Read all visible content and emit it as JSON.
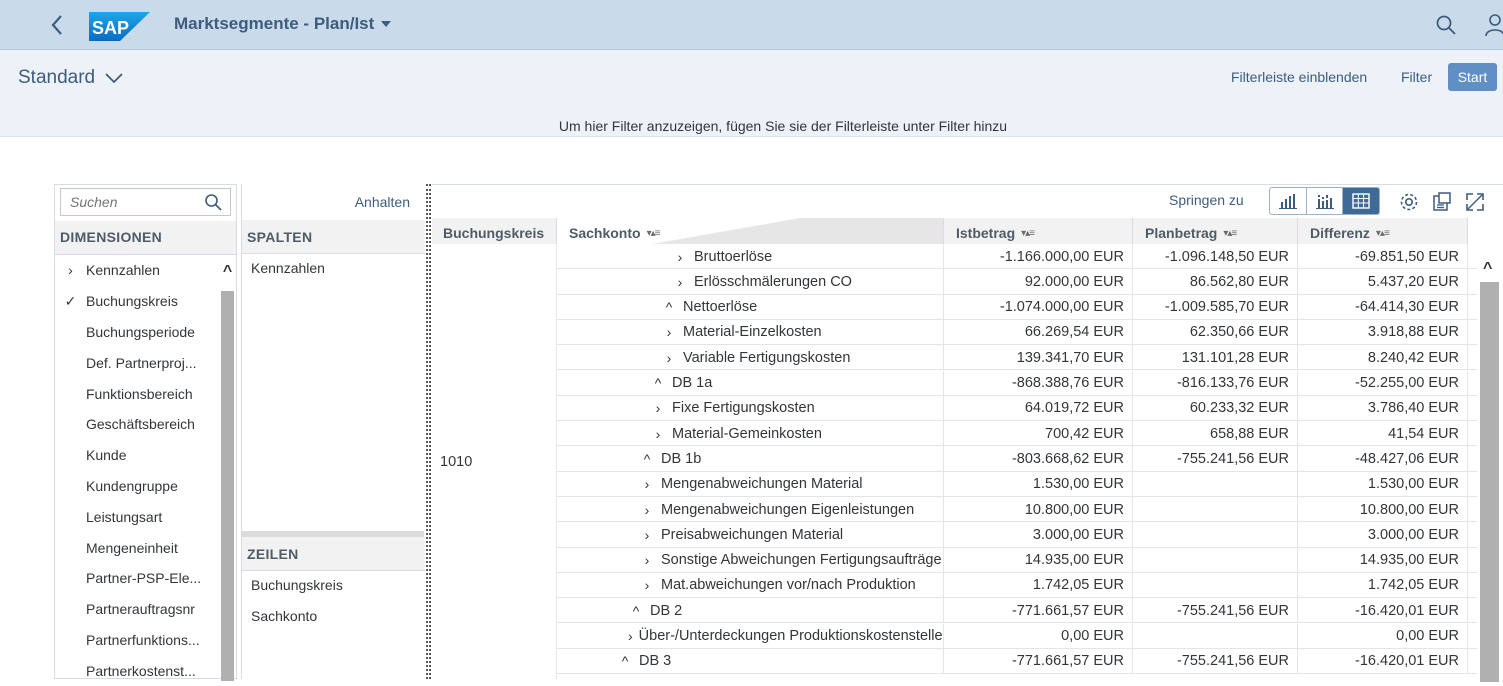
{
  "shell": {
    "logo_text": "SAP",
    "app_title": "Marktsegmente - Plan/Ist"
  },
  "header": {
    "variant": "Standard",
    "show_filterbar": "Filterleiste einblenden",
    "filter": "Filter",
    "start": "Start",
    "hint": "Um hier Filter anzuzeigen, fügen Sie sie der Filterleiste unter Filter hinzu"
  },
  "dimensions": {
    "search_placeholder": "Suchen",
    "heading": "DIMENSIONEN",
    "items": [
      {
        "marker": "›",
        "label": "Kennzahlen"
      },
      {
        "marker": "✓",
        "label": "Buchungskreis"
      },
      {
        "marker": "",
        "label": "Buchungsperiode"
      },
      {
        "marker": "",
        "label": "Def. Partnerproj..."
      },
      {
        "marker": "",
        "label": "Funktionsbereich"
      },
      {
        "marker": "",
        "label": "Geschäftsbereich"
      },
      {
        "marker": "",
        "label": "Kunde"
      },
      {
        "marker": "",
        "label": "Kundengruppe"
      },
      {
        "marker": "",
        "label": "Leistungsart"
      },
      {
        "marker": "",
        "label": "Mengeneinheit"
      },
      {
        "marker": "",
        "label": "Partner-PSP-Ele..."
      },
      {
        "marker": "",
        "label": "Partnerauftragsnr"
      },
      {
        "marker": "",
        "label": "Partnerfunktions..."
      },
      {
        "marker": "",
        "label": "Partnerkostenst..."
      }
    ]
  },
  "layout": {
    "pause": "Anhalten",
    "columns_heading": "SPALTEN",
    "columns": [
      "Kennzahlen"
    ],
    "rows_heading": "ZEILEN",
    "rows": [
      "Buchungskreis",
      "Sachkonto"
    ]
  },
  "grid_toolbar": {
    "jump_to": "Springen zu",
    "icons": [
      "bar-chart-icon",
      "column-chart-icon",
      "table-icon",
      "settings-icon",
      "export-icon",
      "fullscreen-icon"
    ]
  },
  "grid": {
    "headers": {
      "company_code": "Buchungskreis",
      "account": "Sachkonto",
      "actual": "Istbetrag",
      "plan": "Planbetrag",
      "diff": "Differenz"
    },
    "company_code_value": "1010",
    "rows": [
      {
        "indent": 5,
        "state": "›",
        "label": "Bruttoerlöse",
        "actual": "-1.166.000,00 EUR",
        "plan": "-1.096.148,50 EUR",
        "diff": "-69.851,50 EUR"
      },
      {
        "indent": 5,
        "state": "›",
        "label": "Erlösschmälerungen CO",
        "actual": "92.000,00 EUR",
        "plan": "86.562,80 EUR",
        "diff": "5.437,20 EUR"
      },
      {
        "indent": 4,
        "state": "^",
        "label": "Nettoerlöse",
        "actual": "-1.074.000,00 EUR",
        "plan": "-1.009.585,70 EUR",
        "diff": "-64.414,30 EUR"
      },
      {
        "indent": 4,
        "state": "›",
        "label": "Material-Einzelkosten",
        "actual": "66.269,54 EUR",
        "plan": "62.350,66 EUR",
        "diff": "3.918,88 EUR"
      },
      {
        "indent": 4,
        "state": "›",
        "label": "Variable Fertigungskosten",
        "actual": "139.341,70 EUR",
        "plan": "131.101,28 EUR",
        "diff": "8.240,42 EUR"
      },
      {
        "indent": 3,
        "state": "^",
        "label": "DB 1a",
        "actual": "-868.388,76 EUR",
        "plan": "-816.133,76 EUR",
        "diff": "-52.255,00 EUR"
      },
      {
        "indent": 3,
        "state": "›",
        "label": "Fixe Fertigungskosten",
        "actual": "64.019,72 EUR",
        "plan": "60.233,32 EUR",
        "diff": "3.786,40 EUR"
      },
      {
        "indent": 3,
        "state": "›",
        "label": "Material-Gemeinkosten",
        "actual": "700,42 EUR",
        "plan": "658,88 EUR",
        "diff": "41,54 EUR"
      },
      {
        "indent": 2,
        "state": "^",
        "label": "DB 1b",
        "actual": "-803.668,62 EUR",
        "plan": "-755.241,56 EUR",
        "diff": "-48.427,06 EUR"
      },
      {
        "indent": 2,
        "state": "›",
        "label": "Mengenabweichungen Material",
        "actual": "1.530,00 EUR",
        "plan": "",
        "diff": "1.530,00 EUR"
      },
      {
        "indent": 2,
        "state": "›",
        "label": "Mengenabweichungen Eigenleistungen",
        "actual": "10.800,00 EUR",
        "plan": "",
        "diff": "10.800,00 EUR"
      },
      {
        "indent": 2,
        "state": "›",
        "label": "Preisabweichungen Material",
        "actual": "3.000,00 EUR",
        "plan": "",
        "diff": "3.000,00 EUR"
      },
      {
        "indent": 2,
        "state": "›",
        "label": "Sonstige Abweichungen Fertigungsaufträge",
        "actual": "14.935,00 EUR",
        "plan": "",
        "diff": "14.935,00 EUR"
      },
      {
        "indent": 2,
        "state": "›",
        "label": "Mat.abweichungen vor/nach Produktion",
        "actual": "1.742,05 EUR",
        "plan": "",
        "diff": "1.742,05 EUR"
      },
      {
        "indent": 1,
        "state": "^",
        "label": "DB 2",
        "actual": "-771.661,57 EUR",
        "plan": "-755.241,56 EUR",
        "diff": "-16.420,01 EUR"
      },
      {
        "indent": 1,
        "state": "›",
        "label": "Über-/Unterdeckungen Produktionskostenstellen",
        "actual": "0,00 EUR",
        "plan": "",
        "diff": "0,00 EUR"
      },
      {
        "indent": 0,
        "state": "^",
        "label": "DB 3",
        "actual": "-771.661,57 EUR",
        "plan": "-755.241,56 EUR",
        "diff": "-16.420,01 EUR"
      }
    ]
  }
}
